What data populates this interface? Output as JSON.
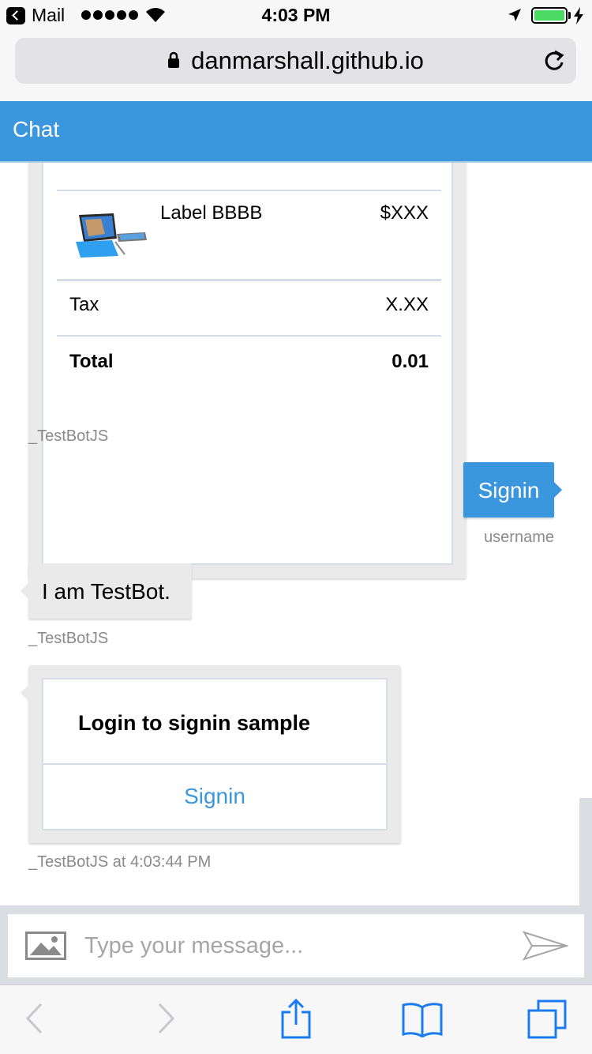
{
  "status_bar": {
    "back_app": "Mail",
    "time": "4:03 PM"
  },
  "browser": {
    "url": "danmarshall.github.io"
  },
  "header": {
    "title": "Chat"
  },
  "receipt": {
    "item": {
      "title": "Label BBBB",
      "price": "$XXX"
    },
    "tax_label": "Tax",
    "tax_value": "X.XX",
    "total_label": "Total",
    "total_value": "0.01",
    "sender": "_TestBotJS"
  },
  "user_message": {
    "text": "Signin",
    "sender": "username"
  },
  "bot_message": {
    "text": "I am TestBot.",
    "sender": "_TestBotJS"
  },
  "signin_card": {
    "title": "Login to signin sample",
    "button_label": "Signin",
    "sender": "_TestBotJS at 4:03:44 PM"
  },
  "input": {
    "placeholder": "Type your message..."
  },
  "colors": {
    "accent": "#3a96dd",
    "bubble_gray": "#eaeaea",
    "battery": "#4cd964"
  },
  "icons": {
    "back": "chevron-left-icon",
    "forward": "chevron-right-icon",
    "share": "share-icon",
    "bookmarks": "bookmarks-icon",
    "tabs": "tabs-icon",
    "reload": "reload-icon",
    "lock": "lock-icon",
    "upload_image": "image-icon",
    "send": "send-icon"
  }
}
